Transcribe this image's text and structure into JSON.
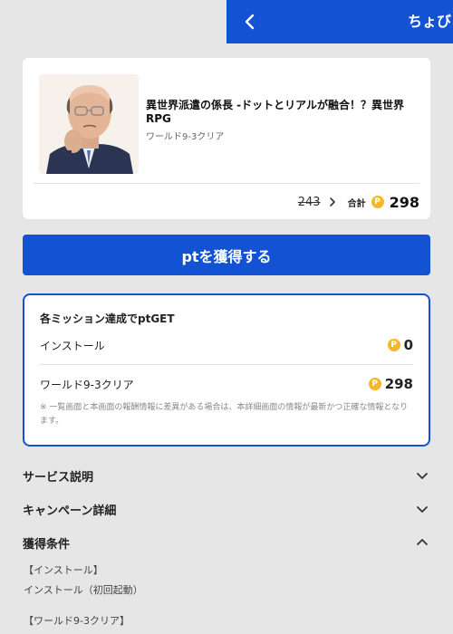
{
  "header": {
    "title": "ちょび",
    "back_icon": "chevron-left-icon",
    "color": "#1252d3"
  },
  "offer": {
    "title": "異世界派遣の係長 -ドットとリアルが融合！？異世界RPG",
    "subtitle": "ワールド9-3クリア",
    "thumbnail": "bald-man-with-glasses-illustration",
    "old_price": "243",
    "total_label": "合計",
    "coin_glyph": "P",
    "total_value": "298"
  },
  "cta": {
    "label": "ptを獲得する"
  },
  "missions": {
    "title": "各ミッション達成でptGET",
    "items": [
      {
        "label": "インストール",
        "value": "0"
      },
      {
        "label": "ワールド9-3クリア",
        "value": "298"
      }
    ],
    "note": "※ 一覧画面と本画面の報酬情報に差異がある場合は、本詳細画面の情報が最新かつ正確な情報となります。"
  },
  "sections": [
    {
      "title": "サービス説明",
      "state": "collapsed"
    },
    {
      "title": "キャンペーン詳細",
      "state": "collapsed"
    },
    {
      "title": "獲得条件",
      "state": "expanded"
    }
  ],
  "conditions": [
    "【インストール】",
    "インストール（初回起動）",
    "【ワールド9-3クリア】"
  ],
  "colors": {
    "accent": "#1252d3",
    "coin": "#f4b829",
    "background": "#e6e6e6"
  }
}
